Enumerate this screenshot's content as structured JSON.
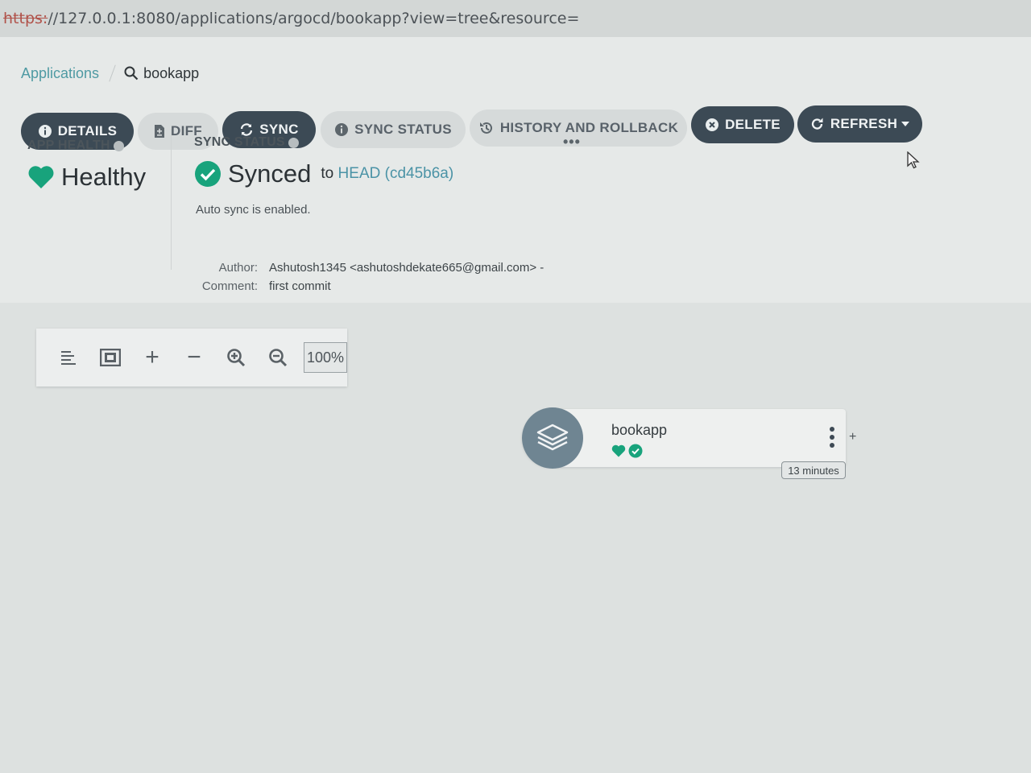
{
  "url": {
    "scheme": "https:",
    "rest": "//127.0.0.1:8080/applications/argocd/bookapp?view=tree&resource="
  },
  "breadcrumb": {
    "applications": "Applications",
    "current": "bookapp"
  },
  "actions": {
    "details": "DETAILS",
    "diff": "DIFF",
    "sync": "SYNC",
    "sync_status": "SYNC STATUS",
    "history": "HISTORY AND ROLLBACK",
    "delete": "DELETE",
    "refresh": "REFRESH"
  },
  "health": {
    "title": "APP HEALTH",
    "value": "Healthy"
  },
  "sync": {
    "title": "SYNC STATUS",
    "value": "Synced",
    "to": "to",
    "revision": "HEAD (cd45b6a)",
    "auto_sync": "Auto sync is enabled.",
    "author_label": "Author:",
    "author_value": "Ashutosh1345 <ashutoshdekate665@gmail.com> -",
    "comment_label": "Comment:",
    "comment_value": "first commit"
  },
  "more_menu": "•••",
  "graph_toolbar": {
    "zoom": "100%",
    "plus": "+",
    "minus": "−"
  },
  "node": {
    "name": "bookapp",
    "age": "13 minutes",
    "expand": "+"
  },
  "colors": {
    "dark_button": "#3c4a55",
    "healthy_green": "#18be94",
    "link_teal": "#4b93a6"
  },
  "icons": {
    "details": "info-icon",
    "diff": "file-diff-icon",
    "sync": "sync-icon",
    "sync_status": "info-icon",
    "history": "history-icon",
    "delete": "close-circle-icon",
    "refresh": "refresh-icon"
  }
}
